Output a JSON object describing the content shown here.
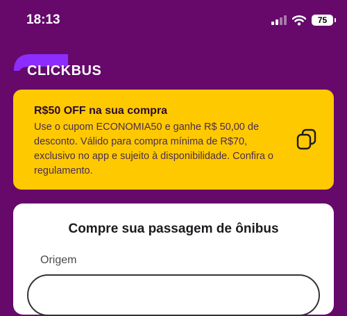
{
  "status_bar": {
    "time": "18:13",
    "battery": "75"
  },
  "brand": {
    "logo_text": "CLICKBUS"
  },
  "promo": {
    "title": "R$50 OFF na sua compra",
    "body": "Use o cupom ECONOMIA50 e ganhe R$ 50,00 de desconto. Válido para compra mínima de R$70, exclusivo no app e sujeito à disponibilidade. Confira o regulamento.",
    "copy_icon": "copy-icon"
  },
  "search": {
    "title": "Compre sua passagem de ônibus",
    "origin_label": "Origem",
    "origin_placeholder": ""
  },
  "colors": {
    "background": "#66096b",
    "promo": "#ffc900",
    "accent": "#8d2cff"
  }
}
